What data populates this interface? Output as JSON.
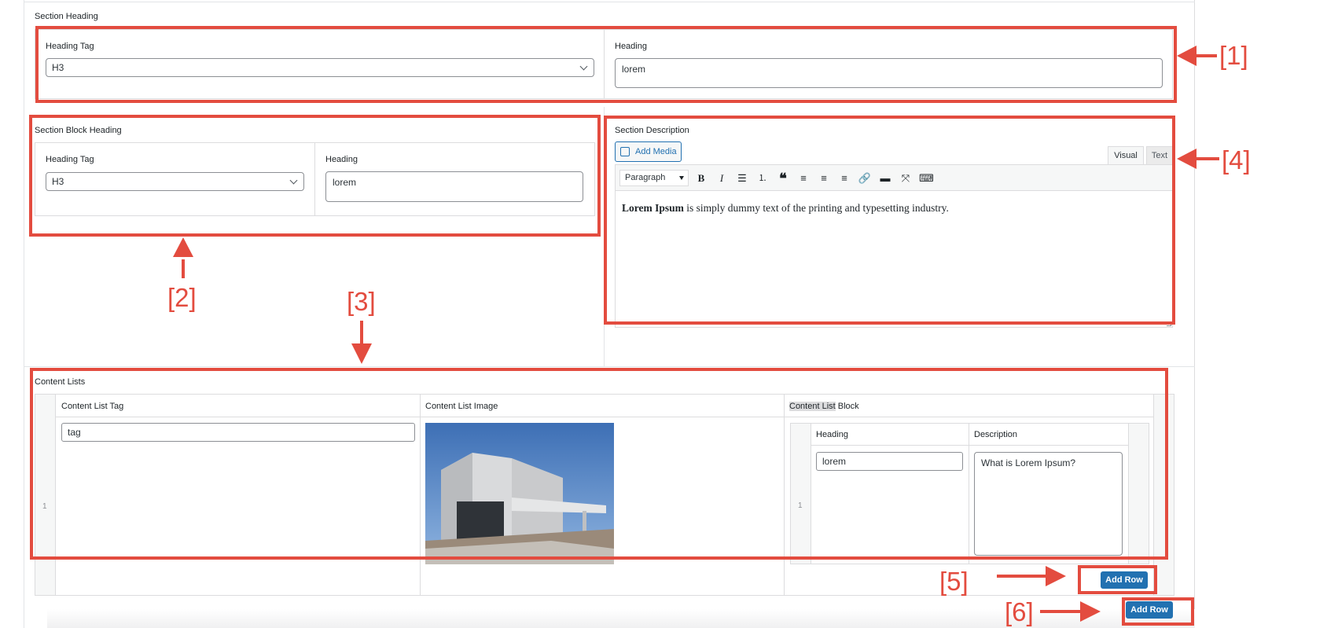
{
  "section_heading": {
    "title": "Section Heading",
    "tag_label": "Heading Tag",
    "tag_value": "H3",
    "heading_label": "Heading",
    "heading_value": "lorem"
  },
  "section_block_heading": {
    "title": "Section Block Heading",
    "tag_label": "Heading Tag",
    "tag_value": "H3",
    "heading_label": "Heading",
    "heading_value": "lorem"
  },
  "section_description": {
    "title": "Section Description",
    "add_media_label": "Add Media",
    "tab_visual": "Visual",
    "tab_text": "Text",
    "format_value": "Paragraph",
    "content_bold": "Lorem Ipsum",
    "content_rest": " is simply dummy text of the printing and typesetting industry.",
    "toolbar_icons": [
      "bold-icon",
      "italic-icon",
      "bulleted-list-icon",
      "numbered-list-icon",
      "blockquote-icon",
      "align-left-icon",
      "align-center-icon",
      "align-right-icon",
      "link-icon",
      "read-more-icon",
      "fullscreen-icon",
      "toolbar-toggle-icon"
    ]
  },
  "content_lists": {
    "title": "Content Lists",
    "col_tag": "Content List Tag",
    "col_image": "Content List Image",
    "col_block_highlight": "Content List",
    "col_block_rest": " Block",
    "row_number": "1",
    "tag_value": "tag",
    "inner": {
      "col_heading": "Heading",
      "col_description": "Description",
      "row_number": "1",
      "heading_value": "lorem",
      "description_value": "What is Lorem Ipsum?"
    },
    "inner_add_row": "Add Row",
    "outer_add_row": "Add Row"
  },
  "annotations": {
    "a1": "[1]",
    "a2": "[2]",
    "a3": "[3]",
    "a4": "[4]",
    "a5": "[5]",
    "a6": "[6]"
  },
  "colors": {
    "annotation_red": "#e34c3f",
    "wp_blue": "#2271b1"
  }
}
